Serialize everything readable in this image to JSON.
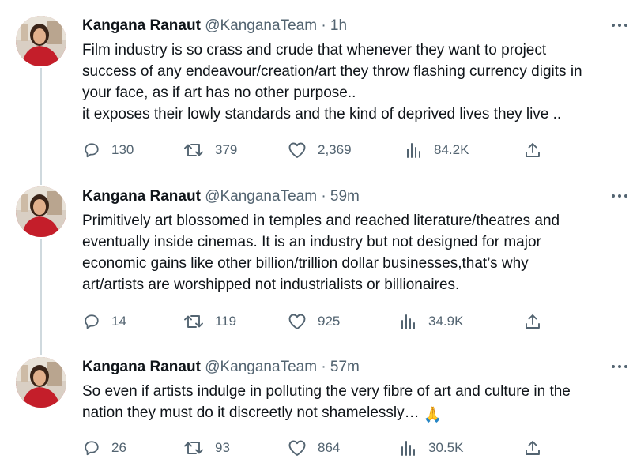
{
  "tweets": [
    {
      "name": "Kangana Ranaut",
      "handle": "@KanganaTeam",
      "dot": "·",
      "time": "1h",
      "text": "Film industry is so crass and crude that whenever they want to project\nsuccess of any endeavour/creation/art they throw flashing currency digits in\nyour face, as if art has no other purpose..\nit exposes their lowly standards and the kind of deprived lives they live ..",
      "replies": "130",
      "retweets": "379",
      "likes": "2,369",
      "views": "84.2K"
    },
    {
      "name": "Kangana Ranaut",
      "handle": "@KanganaTeam",
      "dot": "·",
      "time": "59m",
      "text": "Primitively art blossomed in temples and reached literature/theatres and\neventually inside cinemas. It is an industry but not designed for major\neconomic gains like other billion/trillion dollar businesses,that’s why\nart/artists are worshipped not industrialists or billionaires.",
      "replies": "14",
      "retweets": "119",
      "likes": "925",
      "views": "34.9K"
    },
    {
      "name": "Kangana Ranaut",
      "handle": "@KanganaTeam",
      "dot": "·",
      "time": "57m",
      "text": "So even if artists indulge in polluting the very fibre of art and culture in the\nnation they must do it discreetly not shamelessly… ",
      "emoji": "🙏",
      "replies": "26",
      "retweets": "93",
      "likes": "864",
      "views": "30.5K"
    }
  ],
  "icons": {
    "more": "more-horizontal-icon",
    "reply": "reply-icon",
    "retweet": "retweet-icon",
    "like": "heart-icon",
    "views": "views-bar-chart-icon",
    "share": "share-icon"
  },
  "colors": {
    "text": "#0f1419",
    "secondary": "#536471",
    "thread_line": "#cfd9de",
    "avatar_red": "#c41e2a"
  }
}
